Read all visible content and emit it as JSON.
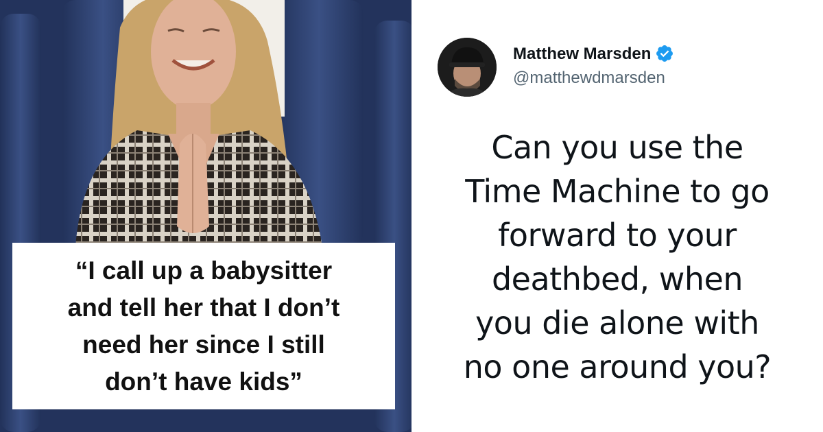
{
  "quote": {
    "text": "“I call up a babysitter\nand tell her that I don’t\nneed her since I still\ndon’t have kids”"
  },
  "tweet": {
    "author_name": "Matthew Marsden",
    "author_handle": "@matthewdmarsden",
    "verified": true,
    "body": "Can you use the\nTime Machine to go\nforward to your\ndeathbed, when\nyou die alone with\nno one around you?"
  },
  "colors": {
    "seat_blue": "#2d3f6a",
    "verified_blue": "#1d9bf0",
    "handle_gray": "#536471",
    "text_dark": "#0f1419"
  }
}
